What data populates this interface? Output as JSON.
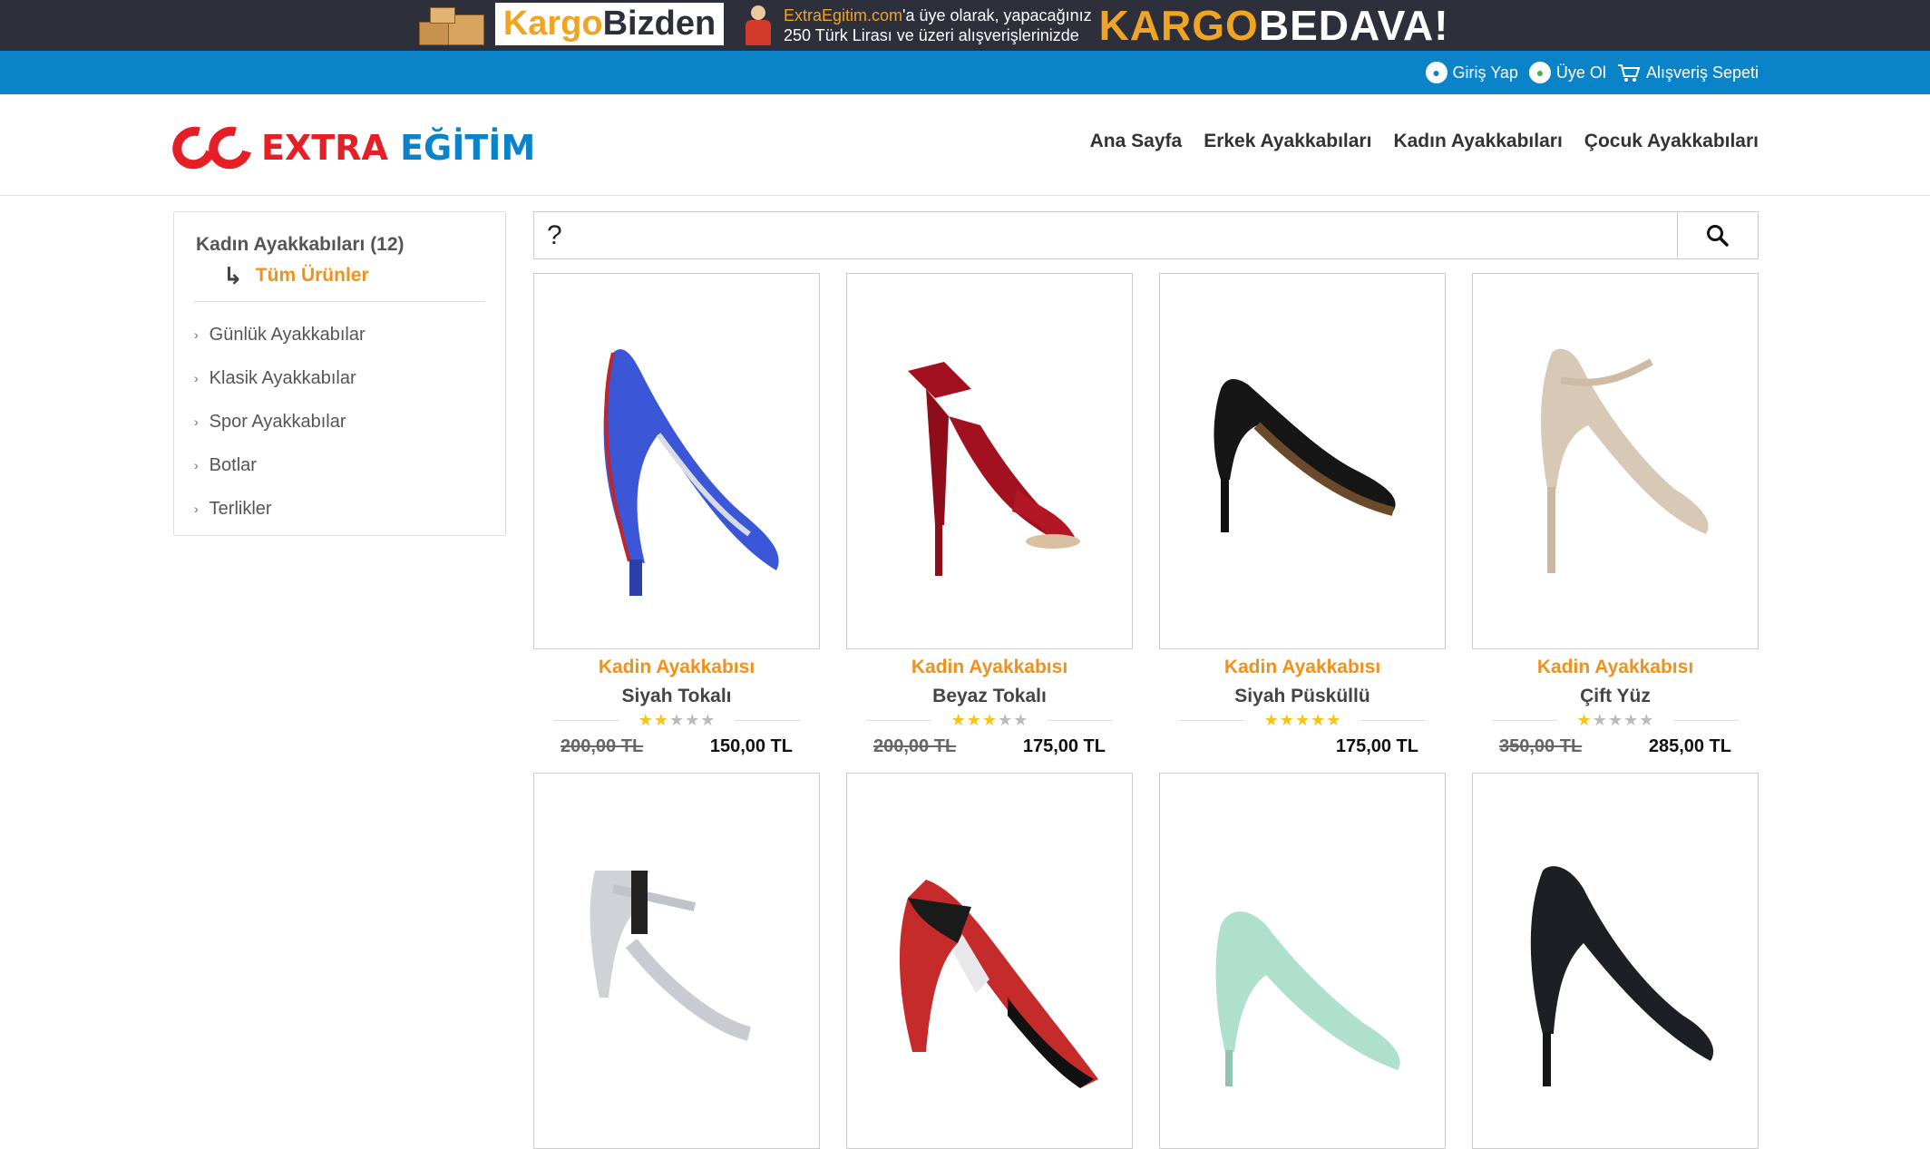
{
  "promo": {
    "brand_kargo": "Kargo",
    "brand_bizden": "Bizden",
    "line1_site": "ExtraEgitim.com",
    "line1_rest": "'a üye olarak, yapacağınız",
    "line2": "250 Türk Lirası ve üzeri alışverişlerinizde",
    "big_kargo": "KARGO",
    "big_bedava": "BEDAVA!"
  },
  "userbar": {
    "login": "Giriş Yap",
    "register": "Üye Ol",
    "cart": "Alışveriş Sepeti"
  },
  "logo": {
    "extra": "EXTRA",
    "egitim": "EĞİTİM"
  },
  "nav": [
    "Ana Sayfa",
    "Erkek Ayakkabıları",
    "Kadın Ayakkabıları",
    "Çocuk Ayakkabıları"
  ],
  "sidebar": {
    "title": "Kadın Ayakkabıları (12)",
    "all": "Tüm Ürünler",
    "items": [
      "Günlük Ayakkabılar",
      "Klasik Ayakkabılar",
      "Spor Ayakkabılar",
      "Botlar",
      "Terlikler"
    ]
  },
  "search": {
    "value": "?"
  },
  "colors": {
    "accent_orange": "#f0911c",
    "blue_bar": "#0b83c9",
    "promo_bg": "#2d2f3b",
    "logo_red": "#e61e25"
  },
  "products": [
    {
      "category": "Kadin Ayakkabısı",
      "name": "Siyah Tokalı",
      "rating": 2,
      "old_price": "200,00 TL",
      "price": "150,00 TL",
      "shoe": "blue-pump"
    },
    {
      "category": "Kadin Ayakkabısı",
      "name": "Beyaz Tokalı",
      "rating": 3,
      "old_price": "200,00 TL",
      "price": "175,00 TL",
      "shoe": "red-sandal"
    },
    {
      "category": "Kadin Ayakkabısı",
      "name": "Siyah Püsküllü",
      "rating": 5,
      "old_price": "",
      "price": "175,00 TL",
      "shoe": "black-pump"
    },
    {
      "category": "Kadin Ayakkabısı",
      "name": "Çift Yüz",
      "rating": 1,
      "old_price": "350,00 TL",
      "price": "285,00 TL",
      "shoe": "beige-pump"
    },
    {
      "category": "",
      "name": "",
      "rating": 0,
      "old_price": "",
      "price": "",
      "shoe": "silver-sandal"
    },
    {
      "category": "",
      "name": "",
      "rating": 0,
      "old_price": "",
      "price": "",
      "shoe": "red-black-pump"
    },
    {
      "category": "",
      "name": "",
      "rating": 0,
      "old_price": "",
      "price": "",
      "shoe": "mint-pump"
    },
    {
      "category": "",
      "name": "",
      "rating": 0,
      "old_price": "",
      "price": "",
      "shoe": "black-leather-pump"
    }
  ]
}
